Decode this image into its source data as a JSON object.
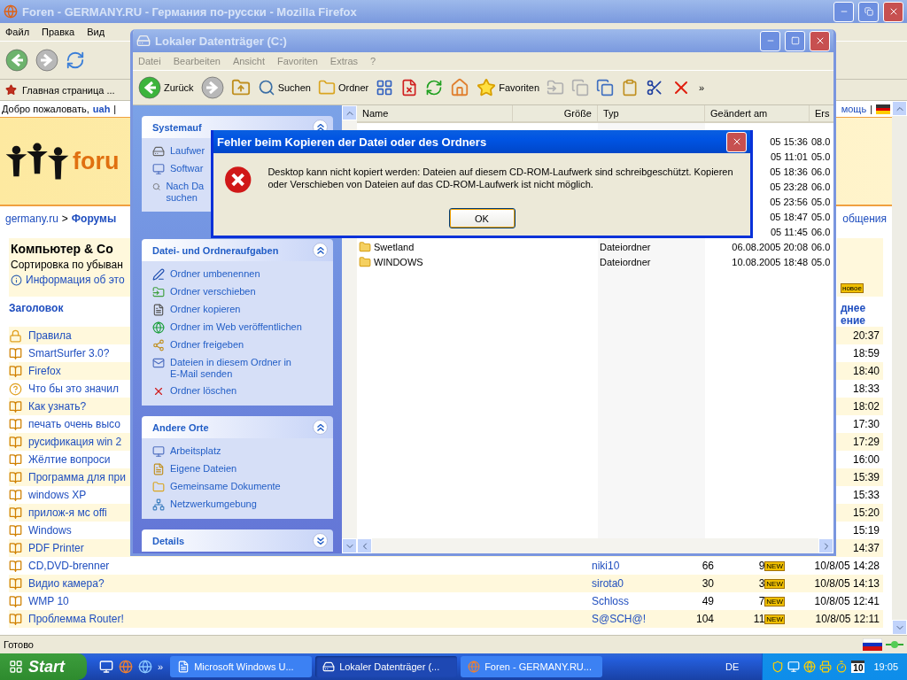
{
  "browser": {
    "title": "Foren - GERMANY.RU - Германия по-русски - Mozilla Firefox",
    "menu": [
      "Файл",
      "Правка",
      "Вид"
    ],
    "bookmarks": [
      "Главная страница ..."
    ],
    "status": "Готово"
  },
  "forum": {
    "welcome": {
      "text": "Добро пожаловать,",
      "user": "uah",
      "separator": "|",
      "help": "мощь",
      "help_separator": "|"
    },
    "logo": "foru",
    "breadcrumb": {
      "site": "germany.ru",
      "separator": ">",
      "section": "Форумы",
      "right_link": "общения"
    },
    "heading": "Компьютер & Со",
    "sort": "Сортировка по убыван",
    "info": "Информация об это",
    "new_badge": "новое",
    "title_column": "Заголовок",
    "last_column": [
      "днее",
      "ение"
    ],
    "threads": [
      {
        "kind": "lock",
        "title": "Правила",
        "last": "20:37"
      },
      {
        "kind": "book",
        "title": "SmartSurfer 3.0?",
        "last": "18:59"
      },
      {
        "kind": "book",
        "title": "Firefox",
        "last": "18:40"
      },
      {
        "kind": "question",
        "title": "Что бы это значил",
        "last": "18:33"
      },
      {
        "kind": "book",
        "title": "Как узнать?",
        "last": "18:02"
      },
      {
        "kind": "book",
        "title": "печать очень высо",
        "last": "17:30"
      },
      {
        "kind": "book",
        "title": "русификация win 2",
        "last": "17:29"
      },
      {
        "kind": "book",
        "title": "Жёлтие вопроси",
        "last": "16:00"
      },
      {
        "kind": "book",
        "title": "Программа для при",
        "last": "15:39"
      },
      {
        "kind": "book",
        "title": "windows XP",
        "last": "15:33"
      },
      {
        "kind": "book",
        "title": "прилож-я мс offi",
        "last": "15:20"
      },
      {
        "kind": "book",
        "title": "Windows",
        "last": "15:19"
      },
      {
        "kind": "book",
        "title": "PDF Printer",
        "last": "14:37"
      },
      {
        "kind": "book",
        "title": "CD,DVD-brenner",
        "author": "niki10",
        "column_3": "66",
        "column_4": "9",
        "badge": "NEW",
        "last": "10/8/05 14:28"
      },
      {
        "kind": "book",
        "title": "Видио камера?",
        "author": "sirota0",
        "column_3": "30",
        "column_4": "3",
        "badge": "NEW",
        "last": "10/8/05 14:13"
      },
      {
        "kind": "book",
        "title": "WMP 10",
        "author": "Schloss",
        "column_3": "49",
        "column_4": "7",
        "badge": "NEW",
        "last": "10/8/05 12:41"
      },
      {
        "kind": "book",
        "title": "Проблемма Router!",
        "author": "S@SCH@!",
        "column_3": "104",
        "column_4": "11",
        "badge": "NEW",
        "last": "10/8/05 12:11"
      }
    ]
  },
  "explorer": {
    "title": "Lokaler Datenträger (C:)",
    "menu": [
      "Datei",
      "Bearbeiten",
      "Ansicht",
      "Favoriten",
      "Extras",
      "?"
    ],
    "toolbar": [
      {
        "label": "Zurück"
      },
      {
        "label": "Suchen"
      },
      {
        "label": "Ordner"
      },
      {
        "label": "Favoriten"
      }
    ],
    "more": "»",
    "panels": [
      {
        "title": "Systemauf",
        "expanded": true,
        "items": [
          "Laufwer",
          "Softwar",
          "Nach Da suchen"
        ]
      },
      {
        "title": "Datei- und Ordneraufgaben",
        "expanded": true,
        "items": [
          "Ordner umbenennen",
          "Ordner verschieben",
          "Ordner kopieren",
          "Ordner im Web veröffentlichen",
          "Ordner freigeben",
          "Dateien in diesem Ordner in E-Mail senden",
          "Ordner löschen"
        ]
      },
      {
        "title": "Andere Orte",
        "expanded": true,
        "items": [
          "Arbeitsplatz",
          "Eigene Dateien",
          "Gemeinsame Dokumente",
          "Netzwerkumgebung"
        ]
      },
      {
        "title": "Details",
        "expanded": false
      }
    ],
    "columns": [
      "Name",
      "Größe",
      "Typ",
      "Geändert am",
      "Ers"
    ],
    "rows": [
      {
        "modified": "05 15:36",
        "created": "08.0"
      },
      {
        "modified": "05 11:01",
        "created": "05.0"
      },
      {
        "modified": "05 18:36",
        "created": "06.0"
      },
      {
        "modified": "05 23:28",
        "created": "06.0"
      },
      {
        "modified": "05 23:56",
        "created": "05.0"
      },
      {
        "modified": "05 18:47",
        "created": "05.0"
      },
      {
        "modified": "05 11:45",
        "created": "06.0"
      },
      {
        "name": "Swetland",
        "type": "Dateiordner",
        "modified": "06.08.2005 20:08",
        "created": "06.0"
      },
      {
        "name": "WINDOWS",
        "type": "Dateiordner",
        "modified": "10.08.2005 18:48",
        "created": "05.0"
      }
    ]
  },
  "dialog": {
    "title": "Fehler beim Kopieren der Datei oder des Ordners",
    "message": "Desktop kann nicht kopiert werden: Dateien auf diesem CD-ROM-Laufwerk sind schreibgeschützt. Kopieren oder Verschieben von Dateien auf das CD-ROM-Laufwerk ist nicht möglich.",
    "button": "OK"
  },
  "taskbar": {
    "start": "Start",
    "more": "»",
    "tasks": [
      {
        "label": "Microsoft Windows U...",
        "selected": false
      },
      {
        "label": "Lokaler Datenträger (...",
        "selected": true
      },
      {
        "label": "Foren - GERMANY.RU...",
        "selected": false
      }
    ],
    "language": "DE",
    "calendar": "10",
    "clock": "19:05"
  }
}
